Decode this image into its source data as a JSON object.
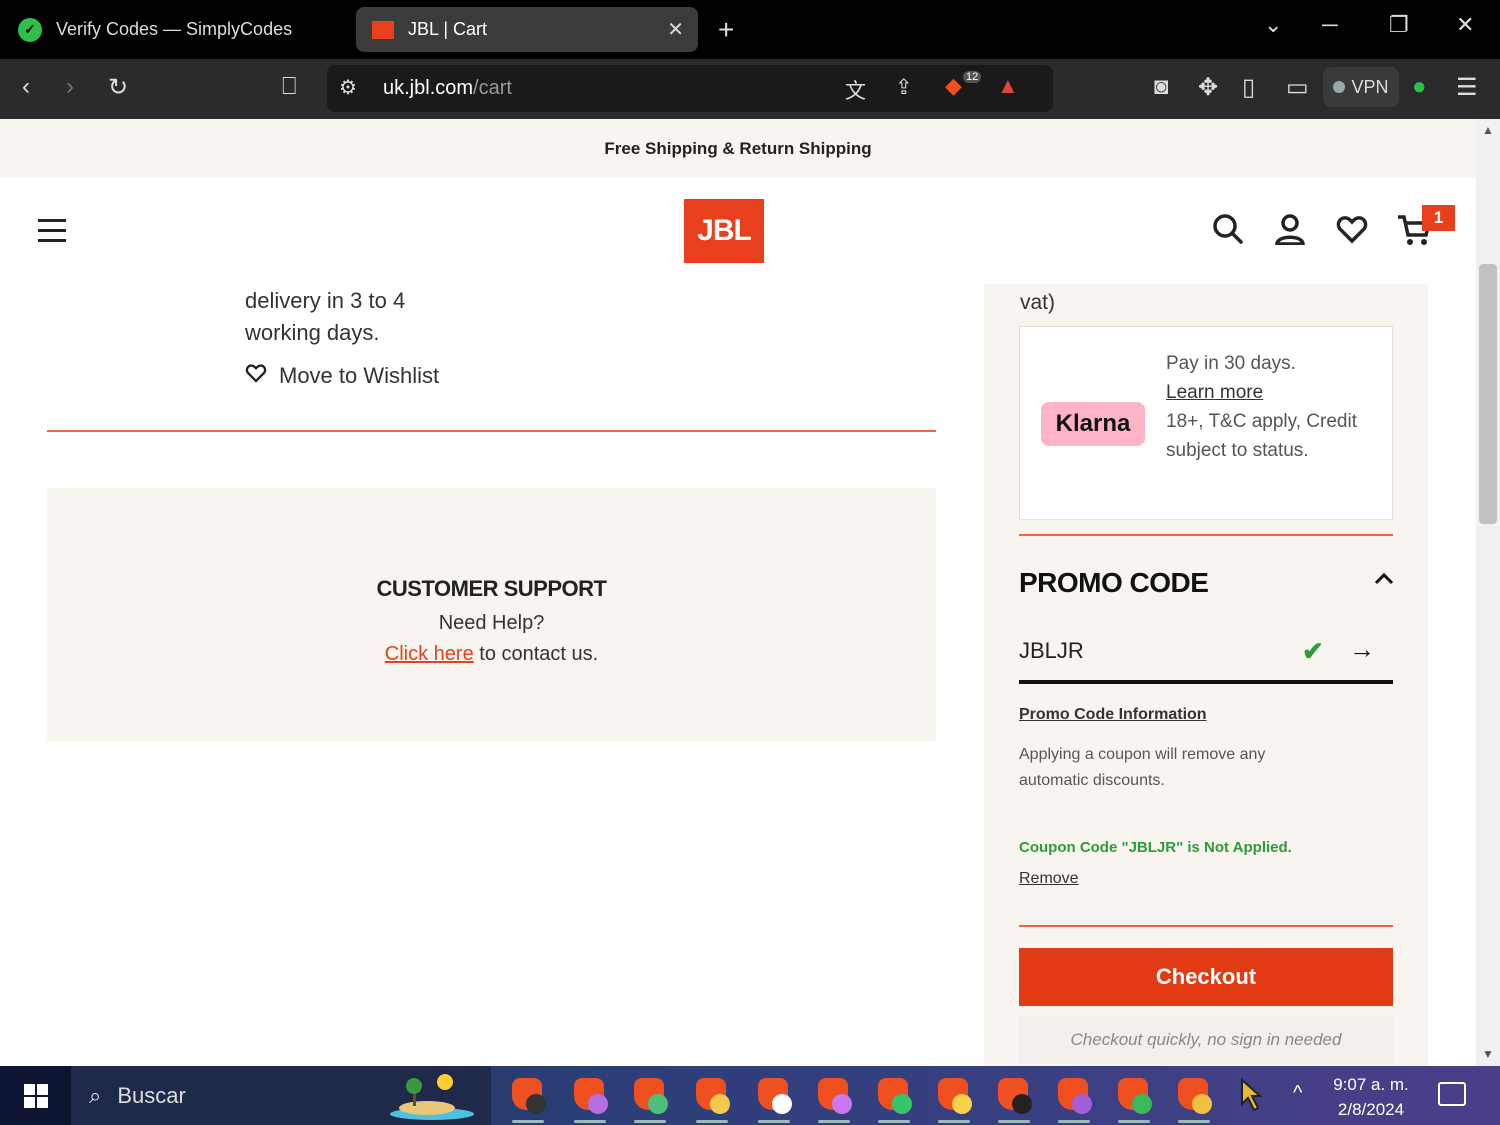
{
  "browser": {
    "tabs": [
      {
        "title": "Verify Codes — SimplyCodes",
        "active": false
      },
      {
        "title": "JBL | Cart",
        "active": true
      }
    ],
    "url_host": "uk.jbl.com",
    "url_path": "/cart",
    "shields_count": "12",
    "vpn_label": "VPN"
  },
  "site": {
    "banner": "Free Shipping & Return Shipping",
    "logo_text": "JBL",
    "cart_count": "1"
  },
  "cart_item": {
    "delivery_line1": "delivery in 3 to 4",
    "delivery_line2": "working days.",
    "wishlist_label": "Move to Wishlist"
  },
  "support": {
    "title": "CUSTOMER SUPPORT",
    "help": "Need Help?",
    "link_text": "Click here",
    "contact_suffix": " to contact us."
  },
  "summary": {
    "vat_text": "vat)",
    "klarna": {
      "logo": "Klarna",
      "pay_text": "Pay in 30 days.",
      "learn_more": "Learn more",
      "terms": "18+, T&C apply, Credit subject to status."
    },
    "promo": {
      "title": "PROMO CODE",
      "code_value": "JBLJR",
      "info_link": "Promo Code Information",
      "description": "Applying a coupon will remove any automatic discounts.",
      "status": "Coupon Code \"JBLJR\" is Not Applied.",
      "remove": "Remove"
    },
    "checkout_label": "Checkout",
    "quick_checkout": "Checkout quickly, no sign in needed"
  },
  "taskbar": {
    "search_label": "Buscar",
    "time": "9:07 a. m.",
    "date": "2/8/2024"
  },
  "colors": {
    "brand": "#e8401c",
    "success": "#2e9a3a",
    "klarna_pink": "#ffb3c7"
  }
}
